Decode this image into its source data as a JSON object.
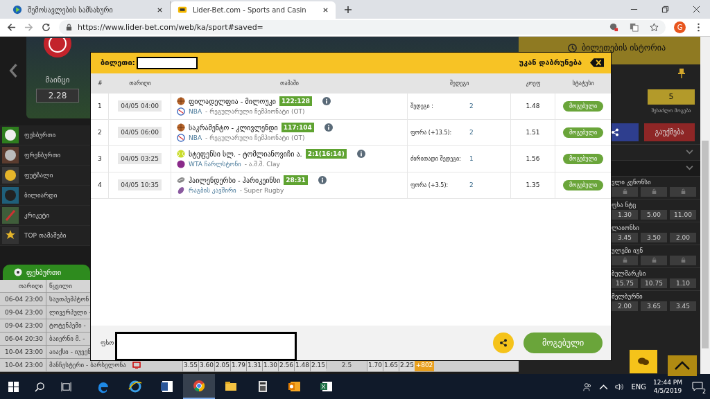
{
  "browser": {
    "tabs": [
      {
        "title": "შემოსავლების სამსახური",
        "kind": "revenue",
        "selected": false
      },
      {
        "title": "Lider-Bet.com - Sports and Casin",
        "kind": "liderbet",
        "selected": true
      }
    ],
    "url": "https://www.lider-bet.com/web/ka/sport#saved=",
    "profile": "G"
  },
  "featured": {
    "team": "მაინცი",
    "odds": "2.28"
  },
  "sports": [
    {
      "label": "ფეხბურთი",
      "kind": "football"
    },
    {
      "label": "ფრენბურთი",
      "kind": "volleyball"
    },
    {
      "label": "ფუტზალი",
      "kind": "futsal"
    },
    {
      "label": "ბილიარდი",
      "kind": "billiards"
    },
    {
      "label": "კრიკეტი",
      "kind": "cricket"
    },
    {
      "label": "TOP თამაშები",
      "kind": "top"
    }
  ],
  "games_table": {
    "tab": "ფეხბურთი",
    "columns": [
      "თარიღი",
      "წყვილი"
    ],
    "rows": [
      {
        "date": "06-04 23:00",
        "match": "საუთჰემპტონ"
      },
      {
        "date": "09-04 23:00",
        "match": "ლივერპული -"
      },
      {
        "date": "09-04 23:00",
        "match": "ტოტენჰემი -"
      },
      {
        "date": "06-04 20:30",
        "match": "ბაიერნი მ. -"
      },
      {
        "date": "10-04 23:00",
        "match": "აიაქსი - იუვენ"
      },
      {
        "date": "10-04 23:00",
        "match": "მანჩესტერი - ბარსელონა",
        "odds": [
          "3.55",
          "3.60",
          "2.05",
          "1.79",
          "1.31",
          "1.30",
          "2.56",
          "1.48",
          "2.15"
        ],
        "total": "2.5",
        "odds_2": [
          "1.70",
          "1.65",
          "2.25"
        ],
        "more": "+802"
      }
    ]
  },
  "ticket_history": {
    "title": "ბილეთების ისტორია",
    "possible_win": "5",
    "possible_win_label": "შესაძლო მოგება",
    "cancel": "გაუქმება",
    "markets": [
      {
        "name": "ვლი კენონსი",
        "locked": true
      },
      {
        "name": "ფსა ნტც",
        "locked": false,
        "odds": [
          "1.30",
          "5.00",
          "11.00"
        ]
      },
      {
        "name": "ლაიონსი",
        "locked": false,
        "odds": [
          "3.45",
          "3.50",
          "2.00"
        ]
      },
      {
        "name": "ულემი იუნ",
        "locked": true
      },
      {
        "name": "ბულშარკსი",
        "locked": false,
        "odds": [
          "15.75",
          "10.75",
          "1.10"
        ]
      },
      {
        "name": "მელბურნი",
        "locked": false,
        "odds": [
          "2.00",
          "3.65",
          "3.45"
        ]
      }
    ]
  },
  "modal": {
    "ticket_label": "ბილეთი:",
    "back": "უკან დაბრუნება",
    "columns": [
      "#",
      "თარიღი",
      "თამაში",
      "შედეგი",
      "კოეფ",
      "სტატუსი"
    ],
    "rows": [
      {
        "n": "1",
        "date": "04/05 04:00",
        "sport_icon": {
          "kind": "basketball"
        },
        "match": "ფილადელფია - მილოუკი",
        "score": "122:128",
        "league": "NBA",
        "league_rest": "- რეგულარული ჩემპიონატი (OT)",
        "league_icon": {
          "kind": "nba"
        },
        "bet": "შედეგი :",
        "bet_value": "2",
        "odds": "1.48",
        "status": "მოგებული"
      },
      {
        "n": "2",
        "date": "04/05 06:00",
        "sport_icon": {
          "kind": "basketball"
        },
        "match": "საკრამენტო - კლივლენდი",
        "score": "117:104",
        "league": "NBA",
        "league_rest": "- რეგულარული ჩემპიონატი (OT)",
        "league_icon": {
          "kind": "nba"
        },
        "bet": "ფორა (+13.5):",
        "bet_value": "2",
        "odds": "1.51",
        "status": "მოგებული"
      },
      {
        "n": "3",
        "date": "04/05 03:25",
        "sport_icon": {
          "kind": "tennis"
        },
        "match": "სტეფენსი სლ. - ტომლიანოვიჩი ა.",
        "score": "2:1(16:14)",
        "league": "WTA ჩარლსტონი",
        "league_rest": "- ა.შ.შ. Clay",
        "league_icon": {
          "kind": "wta"
        },
        "bet": "ძირითადი შედეგი:",
        "bet_value": "1",
        "odds": "1.56",
        "status": "მოგებული"
      },
      {
        "n": "4",
        "date": "04/05 10:35",
        "sport_icon": {
          "kind": "rugby"
        },
        "match": "ჰაილენდერსი - ჰარიკეინსი",
        "score": "28:31",
        "league": "რაგბის კავშირი",
        "league_rest": "- Super Rugby",
        "league_icon": {
          "kind": "rugby"
        },
        "bet": "ფორა (+3.5):",
        "bet_value": "2",
        "odds": "1.35",
        "status": "მოგებული"
      }
    ],
    "stake_label": "ფსო",
    "status_button": "მოგებული"
  },
  "taskbar": {
    "apps": [
      {
        "kind": "edge",
        "selected": false
      },
      {
        "kind": "ie",
        "selected": false
      },
      {
        "kind": "word",
        "selected": false
      },
      {
        "kind": "chrome",
        "selected": true
      },
      {
        "kind": "folder",
        "selected": false
      },
      {
        "kind": "calculator",
        "selected": false
      },
      {
        "kind": "outlook",
        "selected": false
      },
      {
        "kind": "excel",
        "selected": false
      }
    ],
    "language": "ENG",
    "time": "12:44 PM",
    "date": "4/5/2019",
    "notifications": "2"
  }
}
